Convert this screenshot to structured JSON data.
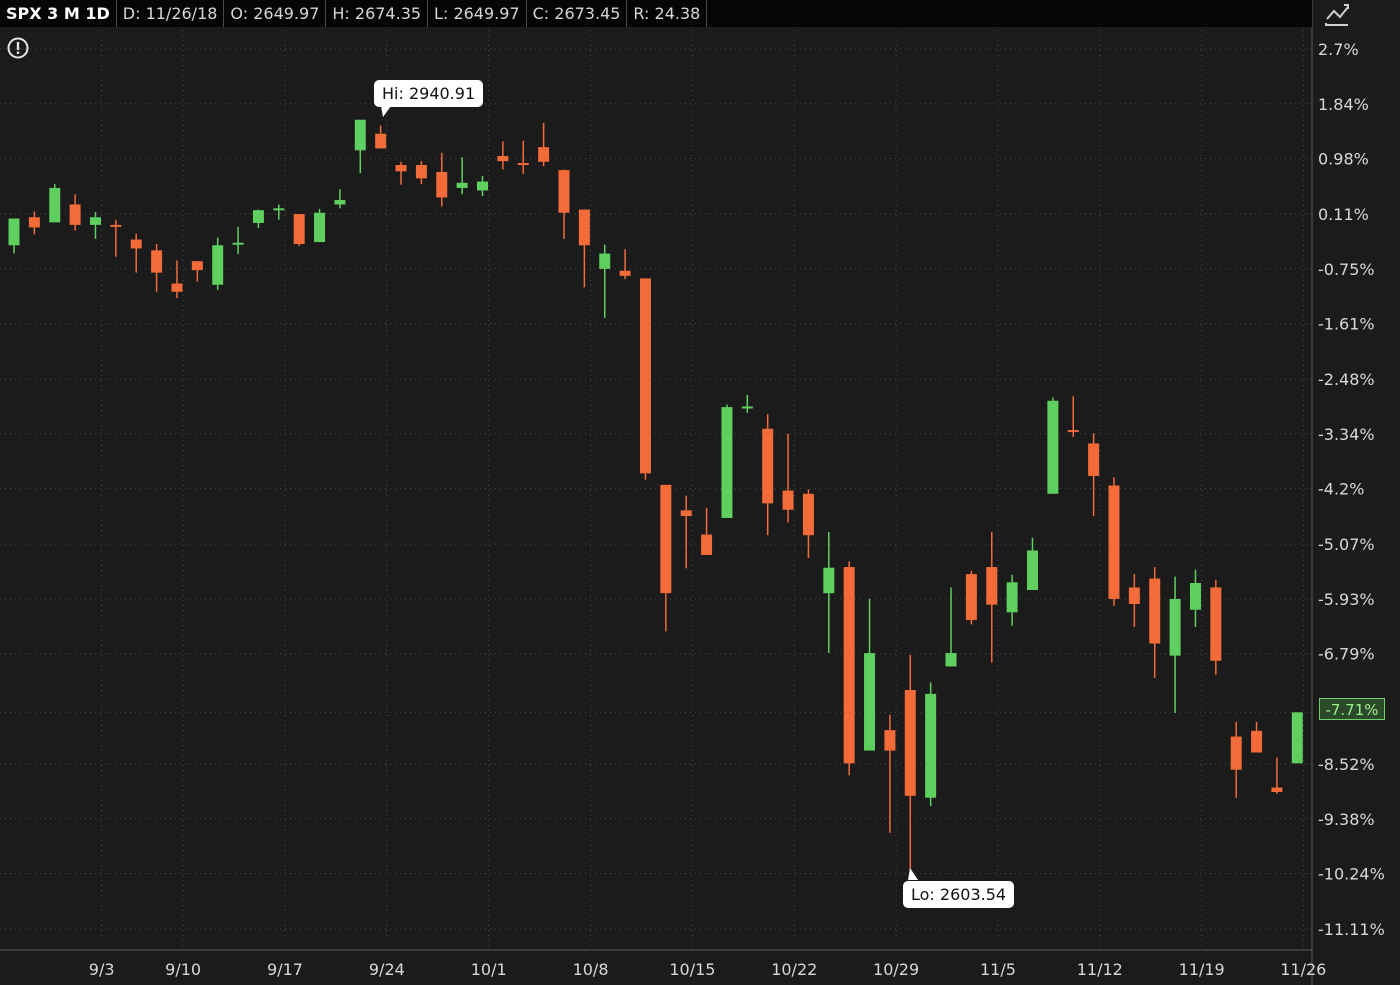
{
  "header": {
    "symbol": "SPX 3 M 1D",
    "date": "D: 11/26/18",
    "open": "O: 2649.97",
    "high": "H: 2674.35",
    "low": "L: 2649.97",
    "close": "C: 2673.45",
    "range": "R: 24.38"
  },
  "annotations": {
    "hi_label": "Hi: 2940.91",
    "lo_label": "Lo: 2603.54",
    "last_value": "-7.71%"
  },
  "colors": {
    "up": "#5fcf5f",
    "down": "#f26b38",
    "background": "#1b1b1b",
    "grid": "#4a4a4a"
  },
  "icons": [
    "alert-icon",
    "chart-style-icon"
  ],
  "chart_data": {
    "type": "candlestick",
    "title": "SPX 3 M 1D",
    "y_unit": "% change",
    "ylim": [
      -11.5,
      3.1
    ],
    "y_ticks": [
      "2.7%",
      "1.84%",
      "0.98%",
      "0.11%",
      "-0.75%",
      "-1.61%",
      "-2.48%",
      "-3.34%",
      "-4.2%",
      "-5.07%",
      "-5.93%",
      "-6.79%",
      "-7.71%",
      "-8.52%",
      "-9.38%",
      "-10.24%",
      "-11.11%"
    ],
    "x_ticks": [
      "9/3",
      "9/10",
      "9/17",
      "9/24",
      "10/1",
      "10/8",
      "10/15",
      "10/22",
      "10/29",
      "11/5",
      "11/12",
      "11/19",
      "11/26"
    ],
    "x_tick_day_index": [
      5,
      9,
      14,
      19,
      24,
      29,
      34,
      39,
      44,
      49,
      54,
      59,
      63
    ],
    "grid": true,
    "candles": [
      {
        "day": "8/28",
        "o": -0.38,
        "h": -0.13,
        "l": -0.51,
        "c": 0.04
      },
      {
        "day": "8/29",
        "o": 0.06,
        "h": 0.15,
        "l": -0.21,
        "c": -0.1
      },
      {
        "day": "8/30",
        "o": -0.02,
        "h": 0.58,
        "l": -0.02,
        "c": 0.52
      },
      {
        "day": "8/31",
        "o": 0.26,
        "h": 0.42,
        "l": -0.15,
        "c": -0.06
      },
      {
        "day": "9/4",
        "o": -0.06,
        "h": 0.14,
        "l": -0.28,
        "c": 0.06
      },
      {
        "day": "9/5",
        "o": -0.06,
        "h": 0.02,
        "l": -0.56,
        "c": -0.08
      },
      {
        "day": "9/6",
        "o": -0.29,
        "h": -0.2,
        "l": -0.81,
        "c": -0.43
      },
      {
        "day": "9/7",
        "o": -0.46,
        "h": -0.36,
        "l": -1.11,
        "c": -0.81
      },
      {
        "day": "9/10",
        "o": -0.98,
        "h": -0.62,
        "l": -1.21,
        "c": -1.11
      },
      {
        "day": "9/11",
        "o": -0.63,
        "h": -0.63,
        "l": -0.95,
        "c": -0.77
      },
      {
        "day": "9/12",
        "o": -1.0,
        "h": -0.26,
        "l": -1.08,
        "c": -0.38
      },
      {
        "day": "9/13",
        "o": -0.37,
        "h": -0.09,
        "l": -0.52,
        "c": -0.34
      },
      {
        "day": "9/14",
        "o": -0.03,
        "h": 0.18,
        "l": -0.11,
        "c": 0.17
      },
      {
        "day": "9/17",
        "o": 0.2,
        "h": 0.26,
        "l": 0.02,
        "c": 0.2
      },
      {
        "day": "9/18",
        "o": 0.11,
        "h": 0.11,
        "l": -0.39,
        "c": -0.36
      },
      {
        "day": "9/19",
        "o": -0.33,
        "h": 0.19,
        "l": -0.33,
        "c": 0.13
      },
      {
        "day": "9/20",
        "o": 0.26,
        "h": 0.5,
        "l": 0.2,
        "c": 0.33
      },
      {
        "day": "9/21",
        "o": 1.11,
        "h": 1.45,
        "l": 0.75,
        "c": 1.59
      },
      {
        "day": "9/24",
        "o": 1.37,
        "h": 1.5,
        "l": 1.14,
        "c": 1.14
      },
      {
        "day": "9/25",
        "o": 0.88,
        "h": 0.93,
        "l": 0.57,
        "c": 0.78
      },
      {
        "day": "9/26",
        "o": 0.88,
        "h": 0.94,
        "l": 0.58,
        "c": 0.67
      },
      {
        "day": "9/27",
        "o": 0.77,
        "h": 1.07,
        "l": 0.23,
        "c": 0.37
      },
      {
        "day": "9/28",
        "o": 0.52,
        "h": 1.0,
        "l": 0.42,
        "c": 0.6
      },
      {
        "day": "10/1",
        "o": 0.48,
        "h": 0.71,
        "l": 0.39,
        "c": 0.62
      },
      {
        "day": "10/2",
        "o": 1.02,
        "h": 1.25,
        "l": 0.81,
        "c": 0.94
      },
      {
        "day": "10/3",
        "o": 0.91,
        "h": 1.26,
        "l": 0.74,
        "c": 0.89
      },
      {
        "day": "10/4",
        "o": 1.16,
        "h": 1.54,
        "l": 0.86,
        "c": 0.93
      },
      {
        "day": "10/5",
        "o": 0.8,
        "h": 0.81,
        "l": -0.28,
        "c": 0.13
      },
      {
        "day": "10/8",
        "o": 0.18,
        "h": 0.18,
        "l": -1.04,
        "c": -0.38
      },
      {
        "day": "10/9",
        "o": -0.75,
        "h": -0.37,
        "l": -1.52,
        "c": -0.51
      },
      {
        "day": "10/10",
        "o": -0.78,
        "h": -0.44,
        "l": -0.91,
        "c": -0.86
      },
      {
        "day": "10/11",
        "o": -0.9,
        "h": -0.9,
        "l": -4.06,
        "c": -3.96
      },
      {
        "day": "10/12",
        "o": -4.14,
        "h": -4.14,
        "l": -6.44,
        "c": -5.84
      },
      {
        "day": "10/15",
        "o": -4.54,
        "h": -4.31,
        "l": -5.45,
        "c": -4.63
      },
      {
        "day": "10/16",
        "o": -4.92,
        "h": -4.5,
        "l": -5.24,
        "c": -5.24
      },
      {
        "day": "10/17",
        "o": -4.66,
        "h": -2.88,
        "l": -4.47,
        "c": -2.92
      },
      {
        "day": "10/18",
        "o": -2.91,
        "h": -2.73,
        "l": -3.01,
        "c": -2.91
      },
      {
        "day": "10/19",
        "o": -3.26,
        "h": -3.03,
        "l": -4.93,
        "c": -4.43
      },
      {
        "day": "10/22",
        "o": -4.23,
        "h": -3.34,
        "l": -4.73,
        "c": -4.53
      },
      {
        "day": "10/23",
        "o": -4.28,
        "h": -4.21,
        "l": -5.29,
        "c": -4.93
      },
      {
        "day": "10/24",
        "o": -5.84,
        "h": -4.88,
        "l": -6.78,
        "c": -5.44
      },
      {
        "day": "10/25",
        "o": -5.43,
        "h": -5.34,
        "l": -8.7,
        "c": -8.51
      },
      {
        "day": "10/26",
        "o": -8.31,
        "h": -5.93,
        "l": -8.22,
        "c": -6.78
      },
      {
        "day": "10/29",
        "o": -7.99,
        "h": -7.75,
        "l": -9.6,
        "c": -8.31
      },
      {
        "day": "10/30",
        "o": -7.36,
        "h": -6.81,
        "l": -10.26,
        "c": -9.02
      },
      {
        "day": "10/31",
        "o": -9.05,
        "h": -7.24,
        "l": -9.18,
        "c": -7.42
      },
      {
        "day": "11/1",
        "o": -6.99,
        "h": -5.75,
        "l": -6.99,
        "c": -6.78
      },
      {
        "day": "11/2",
        "o": -5.54,
        "h": -5.49,
        "l": -6.33,
        "c": -6.26
      },
      {
        "day": "11/5",
        "o": -5.43,
        "h": -4.88,
        "l": -6.93,
        "c": -6.02
      },
      {
        "day": "11/6",
        "o": -6.14,
        "h": -5.55,
        "l": -6.35,
        "c": -5.67
      },
      {
        "day": "11/7",
        "o": -5.79,
        "h": -4.97,
        "l": -5.79,
        "c": -5.17
      },
      {
        "day": "11/8",
        "o": -4.28,
        "h": -2.77,
        "l": -4.28,
        "c": -2.82
      },
      {
        "day": "11/9",
        "o": -3.28,
        "h": -2.75,
        "l": -3.39,
        "c": -3.31
      },
      {
        "day": "11/12",
        "o": -3.49,
        "h": -3.33,
        "l": -4.63,
        "c": -4.0
      },
      {
        "day": "11/13",
        "o": -4.15,
        "h": -4.02,
        "l": -6.04,
        "c": -5.93
      },
      {
        "day": "11/14",
        "o": -5.75,
        "h": -5.54,
        "l": -6.37,
        "c": -6.01
      },
      {
        "day": "11/15",
        "o": -5.61,
        "h": -5.43,
        "l": -7.17,
        "c": -6.63
      },
      {
        "day": "11/16",
        "o": -6.82,
        "h": -5.58,
        "l": -7.72,
        "c": -5.93
      },
      {
        "day": "11/19",
        "o": -6.1,
        "h": -5.47,
        "l": -6.37,
        "c": -5.68
      },
      {
        "day": "11/20",
        "o": -5.75,
        "h": -5.63,
        "l": -7.12,
        "c": -6.9
      },
      {
        "day": "11/21",
        "o": -8.09,
        "h": -7.86,
        "l": -9.05,
        "c": -8.61
      },
      {
        "day": "11/23",
        "o": -8.0,
        "h": -7.86,
        "l": -8.34,
        "c": -8.34
      },
      {
        "day": "11/24",
        "o": -8.89,
        "h": -8.42,
        "l": -8.99,
        "c": -8.96
      },
      {
        "day": "11/26",
        "o": -8.51,
        "h": -7.71,
        "l": -8.51,
        "c": -7.71
      }
    ]
  }
}
